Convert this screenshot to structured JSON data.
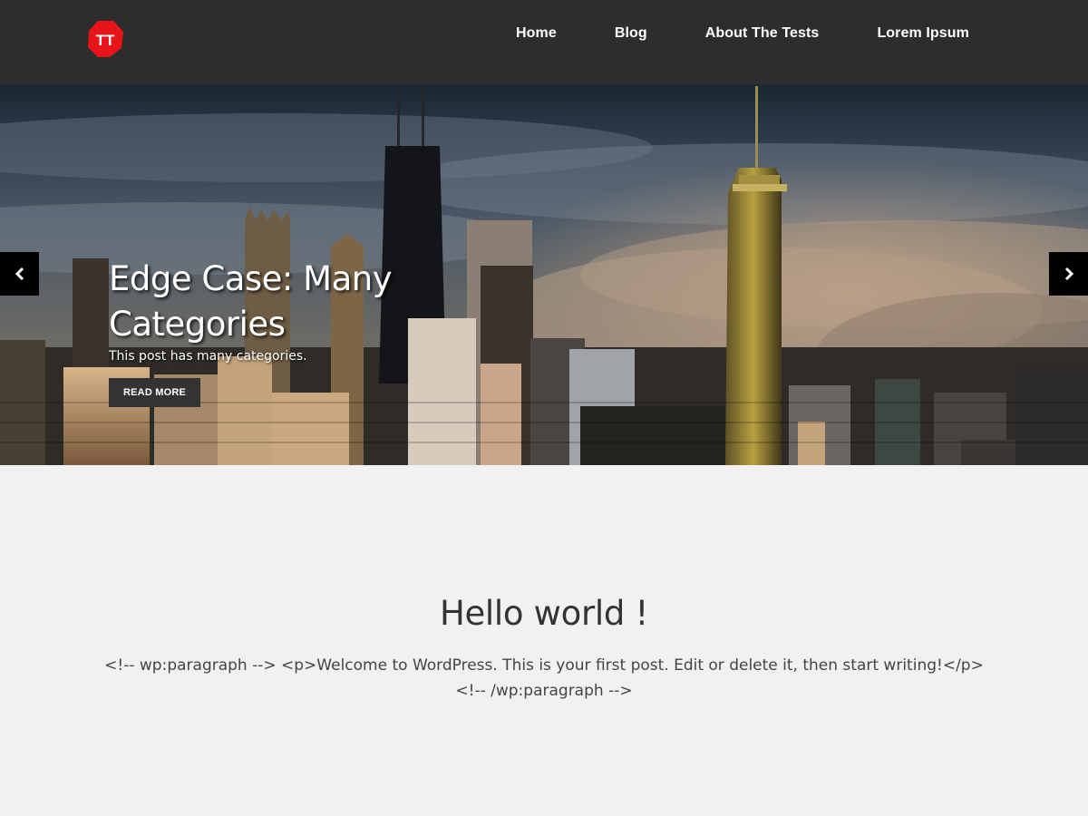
{
  "header": {
    "logo_text": "TT",
    "brand_color": "#e7141a",
    "nav": [
      {
        "label": "Home"
      },
      {
        "label": "Blog"
      },
      {
        "label": "About The Tests"
      },
      {
        "label": "Lorem Ipsum"
      }
    ]
  },
  "slider": {
    "title": "Edge Case: Many Categories",
    "excerpt": "This post has many categories.",
    "button_label": "READ MORE",
    "prev_icon": "chevron-left-icon",
    "next_icon": "chevron-right-icon"
  },
  "post": {
    "title": "Hello world !",
    "body": "<!-- wp:paragraph --> <p>Welcome to WordPress. This is your first post. Edit or delete it, then start writing!</p> <!-- /wp:paragraph -->"
  }
}
